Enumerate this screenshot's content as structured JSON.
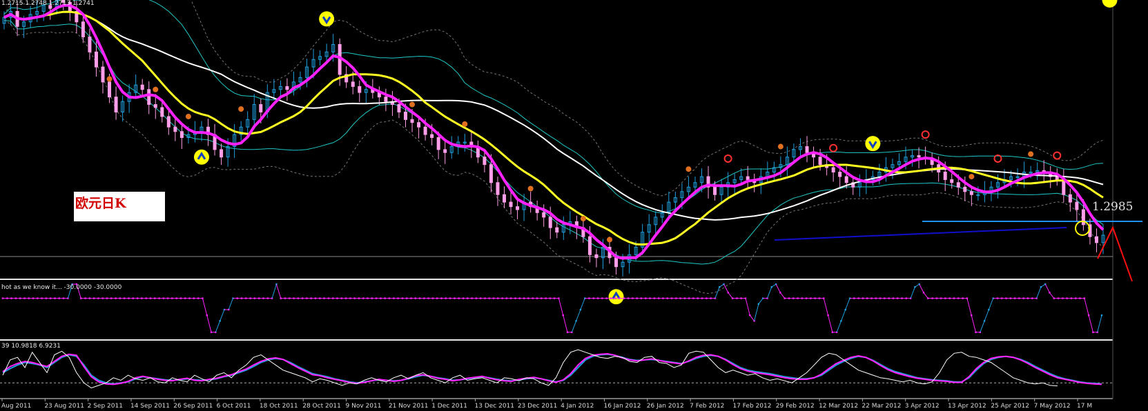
{
  "main_header": "1.2715 1.2748 1.2713 1.2741",
  "overlay_label": "欧元日K",
  "price_label": "1.2985",
  "osc1_header": "hot as we know it... -30.0000 -30.0000",
  "osc2_header": "39 10.9818 6.9231",
  "colors": {
    "background": "#000000",
    "candle_up": "#1ea0e0",
    "candle_down": "#ff9ee8",
    "fast_ma": "#ff22ff",
    "slow_ma": "#ffff22",
    "long_ma": "#ffffff",
    "envelope": "#20c8c8",
    "support_line": "#1e90ff",
    "trend_line": "#1010cc",
    "signal_arrow": "#ffff00",
    "marker_orange": "#e07020",
    "marker_red": "#ff3030"
  },
  "chart_data": [
    {
      "type": "candlestick",
      "instrument": "欧元日K",
      "x_ticks": [
        "Aug 2011",
        "23 Aug 2011",
        "2 Sep 2011",
        "14 Sep 2011",
        "26 Sep 2011",
        "6 Oct 2011",
        "18 Oct 2011",
        "28 Oct 2011",
        "9 Nov 2011",
        "21 Nov 2011",
        "1 Dec 2011",
        "13 Dec 2011",
        "23 Dec 2011",
        "4 Jan 2012",
        "16 Jan 2012",
        "26 Jan 2012",
        "7 Feb 2012",
        "17 Feb 2012",
        "29 Feb 2012",
        "12 Mar 2012",
        "22 Mar 2012",
        "3 Apr 2012",
        "13 Apr 2012",
        "25 Apr 2012",
        "7 May 2012",
        "17 M"
      ],
      "ylim": [
        1.255,
        1.435
      ],
      "close": [
        1.428,
        1.432,
        1.422,
        1.425,
        1.43,
        1.432,
        1.436,
        1.434,
        1.44,
        1.438,
        1.432,
        1.425,
        1.415,
        1.405,
        1.395,
        1.385,
        1.375,
        1.365,
        1.372,
        1.378,
        1.383,
        1.38,
        1.37,
        1.368,
        1.362,
        1.355,
        1.352,
        1.348,
        1.35,
        1.352,
        1.355,
        1.35,
        1.34,
        1.335,
        1.342,
        1.35,
        1.355,
        1.36,
        1.37,
        1.365,
        1.378,
        1.38,
        1.382,
        1.38,
        1.385,
        1.388,
        1.395,
        1.4,
        1.402,
        1.405,
        1.41,
        1.39,
        1.385,
        1.382,
        1.378,
        1.38,
        1.378,
        1.375,
        1.372,
        1.37,
        1.365,
        1.36,
        1.358,
        1.355,
        1.35,
        1.348,
        1.34,
        1.338,
        1.342,
        1.345,
        1.345,
        1.342,
        1.335,
        1.33,
        1.318,
        1.31,
        1.305,
        1.302,
        1.3,
        1.305,
        1.302,
        1.298,
        1.295,
        1.288,
        1.285,
        1.29,
        1.292,
        1.288,
        1.282,
        1.27,
        1.268,
        1.275,
        1.268,
        1.262,
        1.265,
        1.27,
        1.275,
        1.285,
        1.29,
        1.295,
        1.298,
        1.305,
        1.308,
        1.312,
        1.315,
        1.318,
        1.322,
        1.315,
        1.31,
        1.315,
        1.318,
        1.32,
        1.322,
        1.32,
        1.318,
        1.322,
        1.325,
        1.328,
        1.33,
        1.335,
        1.34,
        1.342,
        1.338,
        1.335,
        1.33,
        1.328,
        1.325,
        1.322,
        1.318,
        1.315,
        1.318,
        1.32,
        1.322,
        1.325,
        1.328,
        1.33,
        1.332,
        1.335,
        1.336,
        1.335,
        1.334,
        1.33,
        1.325,
        1.32,
        1.318,
        1.315,
        1.312,
        1.31,
        1.31,
        1.312,
        1.315,
        1.318,
        1.32,
        1.322,
        1.322,
        1.325,
        1.325,
        1.326,
        1.325,
        1.322,
        1.32,
        1.31,
        1.305,
        1.3,
        1.29,
        1.282,
        1.278,
        1.283
      ]
    },
    {
      "type": "line",
      "name": "hot as we know it",
      "ylim": [
        -100,
        0
      ],
      "values": [
        -30,
        -30,
        -30,
        -30,
        -30,
        -30,
        -30,
        -30,
        -30,
        -30,
        -30,
        -30,
        -30,
        -30,
        -30,
        -30,
        -5,
        -5,
        -30,
        -30,
        -30,
        -30,
        -30,
        -30,
        -30,
        -30,
        -30,
        -30,
        -30,
        -30,
        -30,
        -30,
        -30,
        -30,
        -30,
        -30,
        -30,
        -30,
        -30,
        -30,
        -30,
        -30,
        -30,
        -30,
        -30,
        -30,
        -30,
        -60,
        -90,
        -90,
        -70,
        -50,
        -50,
        -30,
        -30,
        -30,
        -30,
        -30,
        -30,
        -30,
        -30,
        -30,
        -30,
        -5,
        -30,
        -30,
        -30,
        -30,
        -30,
        -30,
        -30,
        -30,
        -30,
        -30,
        -30,
        -30,
        -30,
        -30,
        -30,
        -30,
        -30,
        -30,
        -30,
        -30,
        -30,
        -30,
        -30,
        -30,
        -30,
        -30,
        -30,
        -30,
        -30,
        -30,
        -30,
        -30,
        -30,
        -30,
        -30,
        -30,
        -30,
        -30,
        -30,
        -30,
        -30,
        -30,
        -30,
        -30,
        -30,
        -30,
        -30,
        -30,
        -30,
        -30,
        -30,
        -30,
        -30,
        -30,
        -30,
        -30,
        -30,
        -30,
        -30,
        -30,
        -30,
        -30,
        -30,
        -30,
        -30,
        -60,
        -90,
        -90,
        -70,
        -50,
        -30,
        -30,
        -30,
        -30,
        -30,
        -30,
        -30,
        -30,
        -30,
        -30,
        -30,
        -30,
        -30,
        -30,
        -30,
        -30,
        -30,
        -30,
        -30,
        -30,
        -30,
        -30,
        -30,
        -30,
        -30,
        -30,
        -30,
        -30,
        -30,
        -30,
        -30,
        -10,
        -5,
        -20,
        -30,
        -30,
        -30,
        -30,
        -60,
        -70,
        -40,
        -30,
        -30,
        -10,
        -5,
        -20,
        -30,
        -30,
        -30,
        -30,
        -30,
        -30,
        -30,
        -30,
        -30,
        -30,
        -60,
        -90,
        -90,
        -70,
        -50,
        -30,
        -30,
        -30,
        -30,
        -30,
        -30,
        -30,
        -30,
        -30,
        -30,
        -30,
        -30,
        -30,
        -30,
        -30,
        -10,
        -5,
        -20,
        -30,
        -30,
        -30,
        -30,
        -30,
        -30,
        -30,
        -30,
        -30,
        -30,
        -60,
        -90,
        -90,
        -70,
        -50,
        -30,
        -30,
        -30,
        -30,
        -30,
        -30,
        -30,
        -30,
        -30,
        -30,
        -30,
        -10,
        -5,
        -20,
        -30,
        -30,
        -30,
        -30,
        -30,
        -30,
        -30,
        -30,
        -60,
        -90,
        -90,
        -60
      ]
    },
    {
      "type": "line",
      "ylim": [
        0,
        100
      ],
      "series": [
        {
          "values": [
            40,
            48,
            55,
            60,
            58,
            55,
            50,
            60,
            70,
            75,
            72,
            55,
            35,
            25,
            20,
            18,
            20,
            22,
            28,
            32,
            30,
            28,
            26,
            25,
            26,
            28,
            26,
            25,
            26,
            28,
            32,
            35,
            40,
            45,
            52,
            60,
            65,
            68,
            66,
            60,
            52,
            45,
            38,
            35,
            32,
            28,
            25,
            22,
            20,
            22,
            24,
            26,
            25,
            24,
            25,
            28,
            32,
            35,
            33,
            30,
            28,
            25,
            26,
            28,
            30,
            32,
            30,
            27,
            25,
            24,
            26,
            28,
            30,
            28,
            25,
            22,
            25,
            35,
            50,
            65,
            72,
            75,
            76,
            74,
            70,
            66,
            64,
            65,
            66,
            64,
            62,
            60,
            58,
            62,
            68,
            72,
            74,
            72,
            66,
            58,
            50,
            45,
            42,
            40,
            38,
            35,
            32,
            30,
            28,
            28,
            30,
            35,
            45,
            55,
            62,
            68,
            72,
            70,
            64,
            56,
            48,
            42,
            38,
            34,
            30,
            28,
            26,
            25,
            24,
            22,
            22,
            30,
            45,
            58,
            66,
            70,
            72,
            70,
            66,
            60,
            52,
            45,
            38,
            32,
            28,
            25,
            22,
            20,
            19,
            18
          ]
        },
        {
          "values": [
            42,
            52,
            58,
            62,
            60,
            56,
            52,
            62,
            72,
            76,
            74,
            52,
            32,
            22,
            18,
            17,
            19,
            23,
            30,
            33,
            30,
            27,
            25,
            24,
            27,
            29,
            25,
            24,
            27,
            29,
            33,
            36,
            42,
            47,
            55,
            62,
            67,
            69,
            66,
            58,
            50,
            43,
            36,
            34,
            30,
            27,
            24,
            21,
            19,
            21,
            24,
            27,
            25,
            23,
            25,
            29,
            34,
            36,
            33,
            29,
            27,
            24,
            26,
            29,
            31,
            33,
            29,
            26,
            24,
            23,
            27,
            29,
            31,
            28,
            24,
            21,
            26,
            38,
            55,
            68,
            74,
            76,
            77,
            74,
            69,
            65,
            63,
            65,
            67,
            64,
            61,
            59,
            57,
            63,
            70,
            74,
            75,
            72,
            65,
            56,
            48,
            43,
            40,
            38,
            36,
            33,
            30,
            28,
            27,
            27,
            30,
            37,
            48,
            58,
            64,
            70,
            73,
            70,
            63,
            54,
            46,
            40,
            36,
            32,
            29,
            27,
            25,
            24,
            23,
            21,
            21,
            32,
            48,
            60,
            68,
            71,
            72,
            70,
            65,
            58,
            50,
            43,
            36,
            30,
            27,
            24,
            21,
            19,
            18,
            17
          ]
        },
        {
          "values": [
            35,
            65,
            70,
            50,
            80,
            60,
            40,
            75,
            82,
            70,
            40,
            20,
            10,
            15,
            20,
            30,
            25,
            35,
            28,
            25,
            30,
            22,
            20,
            30,
            25,
            22,
            35,
            28,
            22,
            35,
            40,
            30,
            45,
            55,
            70,
            75,
            65,
            55,
            45,
            40,
            35,
            30,
            22,
            28,
            25,
            20,
            15,
            20,
            18,
            25,
            30,
            25,
            22,
            30,
            35,
            28,
            35,
            40,
            30,
            25,
            20,
            30,
            35,
            25,
            28,
            30,
            25,
            20,
            30,
            28,
            24,
            30,
            28,
            20,
            15,
            30,
            60,
            80,
            85,
            80,
            75,
            70,
            68,
            72,
            70,
            62,
            60,
            70,
            72,
            60,
            58,
            50,
            55,
            78,
            82,
            80,
            65,
            50,
            40,
            45,
            40,
            35,
            38,
            30,
            25,
            28,
            24,
            20,
            30,
            40,
            55,
            70,
            78,
            75,
            65,
            55,
            45,
            40,
            35,
            30,
            28,
            25,
            22,
            25,
            20,
            18,
            22,
            40,
            65,
            78,
            80,
            72,
            70,
            65,
            60,
            50,
            40,
            30,
            25,
            20,
            18,
            20,
            15,
            14
          ]
        }
      ]
    }
  ]
}
